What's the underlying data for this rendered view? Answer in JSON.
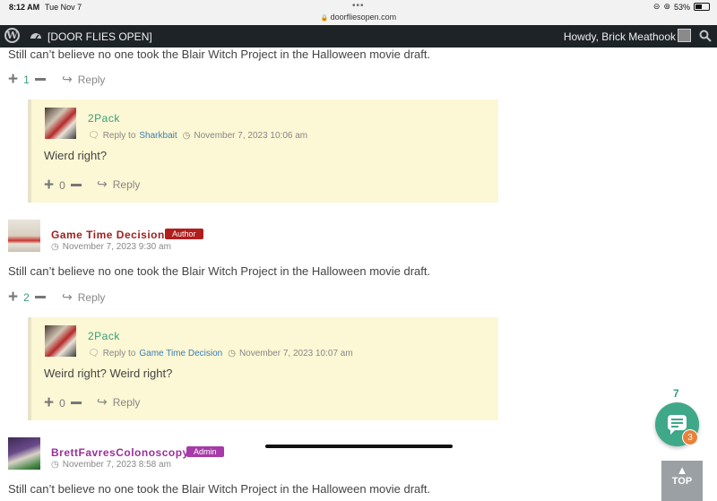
{
  "status_bar": {
    "time": "8:12 AM",
    "date": "Tue Nov 7",
    "url": "doorfliesopen.com",
    "battery": "53%",
    "battery_level": 0.53
  },
  "admin_bar": {
    "site_name": "[DOOR FLIES OPEN]",
    "greeting": "Howdy, Brick Meathook"
  },
  "comments": [
    {
      "text": "Still can’t believe no one took the Blair Witch Project in the Halloween movie draft.",
      "votes": "1",
      "reply_label": "Reply",
      "child": {
        "author": "2Pack",
        "reply_to_label": "Reply to",
        "reply_to": "Sharkbait",
        "date": "November 7, 2023 10:06 am",
        "text": "Wierd right?",
        "votes": "0",
        "reply_label": "Reply"
      }
    },
    {
      "author": "Game Time Decision",
      "badge": "Author",
      "date": "November 7, 2023 9:30 am",
      "text": "Still can’t believe no one took the Blair Witch Project in the Halloween movie draft.",
      "votes": "2",
      "reply_label": "Reply",
      "child": {
        "author": "2Pack",
        "reply_to_label": "Reply to",
        "reply_to": "Game Time Decision",
        "date": "November 7, 2023 10:07 am",
        "text": "Weird right? Weird right?",
        "votes": "0",
        "reply_label": "Reply"
      }
    },
    {
      "author": "BrettFavresColonoscopy",
      "badge": "Admin",
      "date": "November 7, 2023 8:58 am",
      "text": "Still can’t believe no one took the Blair Witch Project in the Halloween movie draft."
    }
  ],
  "floating": {
    "comment_count": "7",
    "badge_count": "3",
    "top_label": "TOP"
  },
  "colors": {
    "author_badge": "#b11e1e",
    "admin_badge": "#a73aa8",
    "accent_green": "#3b9b7a",
    "reply_bg": "#fcf7d4"
  }
}
